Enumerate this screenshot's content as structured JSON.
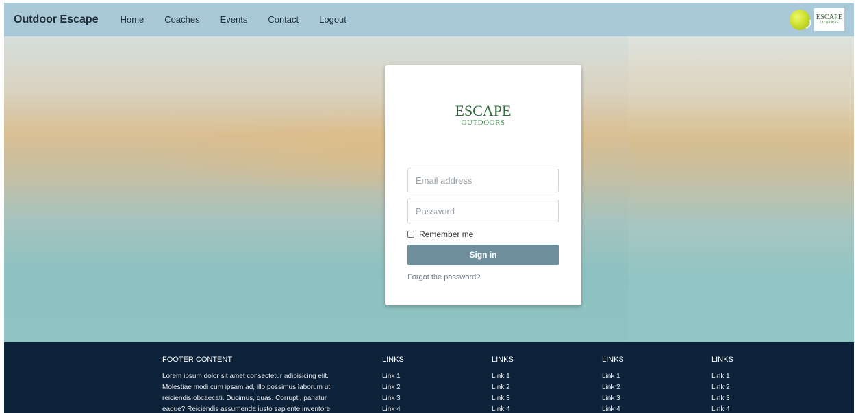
{
  "navbar": {
    "brand": "Outdoor Escape",
    "links": [
      "Home",
      "Coaches",
      "Events",
      "Contact",
      "Logout"
    ],
    "logo_line1": "ESCAPE",
    "logo_line2": "OUTDOORS"
  },
  "login": {
    "logo_line1": "ESCAPE",
    "logo_line2": "OUTDOORS",
    "email_placeholder": "Email address",
    "password_placeholder": "Password",
    "remember_label": "Remember me",
    "signin_label": "Sign in",
    "forgot_label": "Forgot the password?"
  },
  "footer": {
    "content_title": "FOOTER CONTENT",
    "content_text_lines": [
      "Lorem ipsum dolor sit amet consectetur adipisicing elit.",
      "Molestiae modi cum ipsam ad, illo possimus laborum ut",
      "reiciendis obcaecati. Ducimus, quas. Corrupti, pariatur",
      "eaque? Reiciendis assumenda iusto sapiente inventore"
    ],
    "columns": [
      {
        "title": "LINKS",
        "links": [
          "Link 1",
          "Link 2",
          "Link 3",
          "Link 4"
        ]
      },
      {
        "title": "LINKS",
        "links": [
          "Link 1",
          "Link 2",
          "Link 3",
          "Link 4"
        ]
      },
      {
        "title": "LINKS",
        "links": [
          "Link 1",
          "Link 2",
          "Link 3",
          "Link 4"
        ]
      },
      {
        "title": "LINKS",
        "links": [
          "Link 1",
          "Link 2",
          "Link 3",
          "Link 4"
        ]
      }
    ]
  },
  "colors": {
    "navbar_bg": "#a9c8d8",
    "signin_bg": "#6e8e9b",
    "footer_bg": "#0b2238",
    "logo_green": "#2c6a3a"
  },
  "icons": [
    "tennis-ball-icon",
    "escape-outdoors-logo"
  ]
}
